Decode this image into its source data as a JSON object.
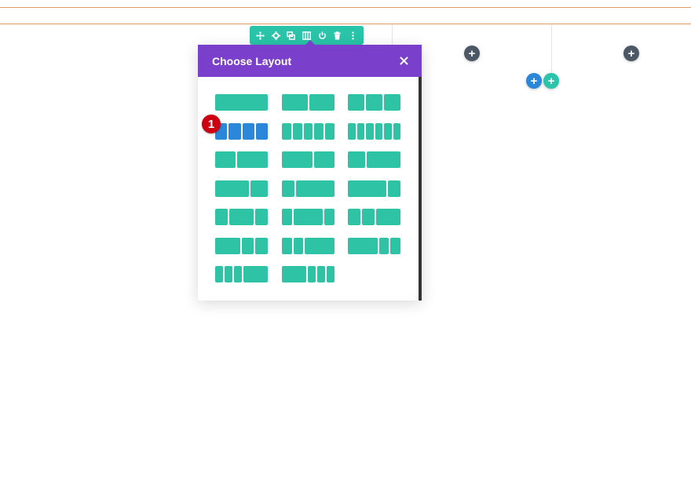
{
  "modal": {
    "title": "Choose Layout",
    "close_icon": "close-icon"
  },
  "colors": {
    "header": "#7a3fcb",
    "toolbar": "#29c4a9",
    "layout_block": "#2fc3a5",
    "layout_selected": "#2b87da",
    "add_dark": "#4c5866",
    "add_blue": "#2b87da",
    "add_teal": "#29c4a9",
    "badge": "#cc0011"
  },
  "row_toolbar": {
    "icons": [
      "move-icon",
      "gear-icon",
      "duplicate-icon",
      "columns-icon",
      "power-icon",
      "trash-icon",
      "more-icon"
    ]
  },
  "badge": {
    "label": "1"
  },
  "add_buttons": {
    "symbol": "+"
  },
  "layouts": [
    {
      "id": "full",
      "cols": [
        1
      ]
    },
    {
      "id": "1-2_1-2",
      "cols": [
        1,
        1
      ]
    },
    {
      "id": "1-3x3",
      "cols": [
        1,
        1,
        1
      ]
    },
    {
      "id": "1-4x4",
      "cols": [
        1,
        1,
        1,
        1
      ],
      "selected": true
    },
    {
      "id": "1-5x5",
      "cols": [
        1,
        1,
        1,
        1,
        1
      ]
    },
    {
      "id": "1-6x6",
      "cols": [
        1,
        1,
        1,
        1,
        1,
        1
      ]
    },
    {
      "id": "2-5_3-5",
      "cols": [
        2,
        3
      ]
    },
    {
      "id": "3-5_2-5",
      "cols": [
        3,
        2
      ]
    },
    {
      "id": "1-3_2-3",
      "cols": [
        1,
        2
      ]
    },
    {
      "id": "2-3_1-3",
      "cols": [
        2,
        1
      ]
    },
    {
      "id": "1-4_3-4",
      "cols": [
        1,
        3
      ]
    },
    {
      "id": "3-4_1-4",
      "cols": [
        3,
        1
      ]
    },
    {
      "id": "1-4_1-2_1-4",
      "cols": [
        1,
        2,
        1
      ]
    },
    {
      "id": "1-5_3-5_1-5",
      "cols": [
        1,
        3,
        1
      ]
    },
    {
      "id": "1-4_1-4_1-2",
      "cols": [
        1,
        1,
        2
      ]
    },
    {
      "id": "1-2_1-4_1-4",
      "cols": [
        2,
        1,
        1
      ]
    },
    {
      "id": "1-5_1-5_3-5",
      "cols": [
        1,
        1,
        3
      ]
    },
    {
      "id": "3-5_1-5_1-5",
      "cols": [
        3,
        1,
        1
      ]
    },
    {
      "id": "1-6x3_1-2",
      "cols": [
        1,
        1,
        1,
        3
      ]
    },
    {
      "id": "1-2_1-6x3",
      "cols": [
        3,
        1,
        1,
        1
      ]
    }
  ]
}
